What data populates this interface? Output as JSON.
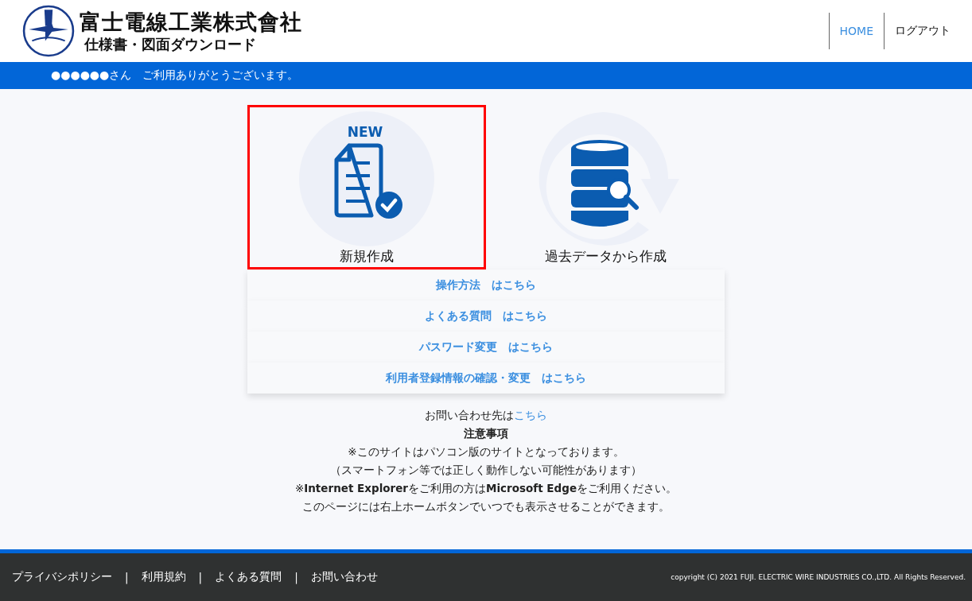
{
  "header": {
    "company": "富士電線工業株式會社",
    "subtitle": "仕様書・図面ダウンロード",
    "nav": [
      {
        "label": "HOME",
        "selected": true
      },
      {
        "label": "ログアウト",
        "selected": false
      }
    ]
  },
  "welcome": "●●●●●●さん　ご利用ありがとうございます。",
  "tiles": [
    {
      "kind": "new",
      "badge": "NEW",
      "label": "新規作成",
      "selected": true
    },
    {
      "kind": "history",
      "label": "過去データから作成",
      "selected": false
    }
  ],
  "links": [
    "操作方法　はこちら",
    "よくある質問　はこちら",
    "パスワード変更　はこちら",
    "利用者登録情報の確認・変更　はこちら"
  ],
  "contact": {
    "text": "お問い合わせ先は",
    "link": "こちら"
  },
  "notice_title": "注意事項",
  "notes": [
    "※このサイトはパソコン版のサイトとなっております。",
    "（スマートフォン等では正しく動作しない可能性があります）",
    "※**Internet Explorer**をご利用の方は**Microsoft Edge**をご利用ください。",
    "このページには右上ホームボタンでいつでも表示させることができます。"
  ],
  "footer": {
    "links": [
      "プライバシポリシー",
      "利用規約",
      "よくある質問",
      "お問い合わせ"
    ],
    "separator": "|",
    "copyright": "copyright (C) 2021 FUJI. ELECTRIC WIRE INDUSTRIES CO.,LTD. All Rights Reserved."
  }
}
